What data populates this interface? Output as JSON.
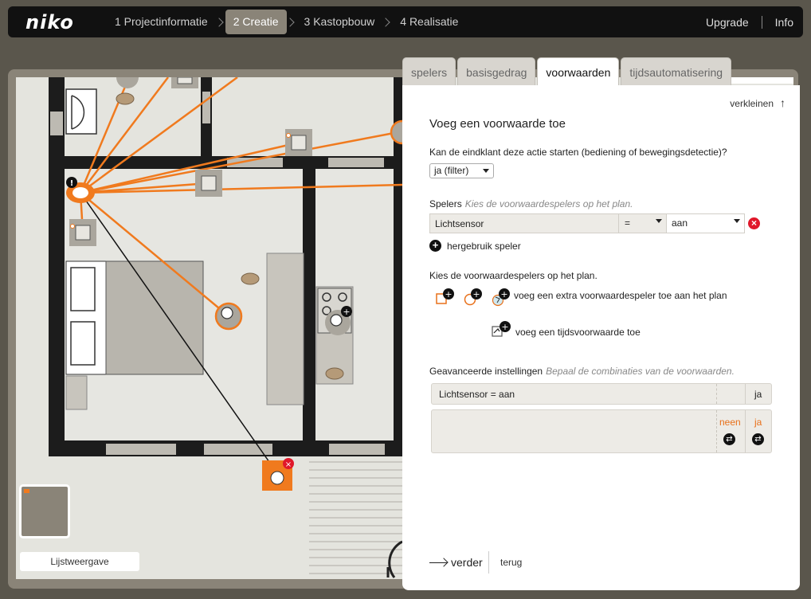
{
  "topbar": {
    "logo": "niko",
    "steps": [
      {
        "label": "1 Projectinformatie",
        "active": false
      },
      {
        "label": "2 Creatie",
        "active": true
      },
      {
        "label": "3 Kastopbouw",
        "active": false
      },
      {
        "label": "4 Realisatie",
        "active": false
      }
    ],
    "upgrade": "Upgrade",
    "info": "Info"
  },
  "plan": {
    "list_view_label": "Lijstweergave"
  },
  "tabs": [
    {
      "label": "spelers",
      "active": false
    },
    {
      "label": "basisgedrag",
      "active": false
    },
    {
      "label": "voorwaarden",
      "active": true
    },
    {
      "label": "tijdsautomatisering",
      "active": false
    }
  ],
  "panel": {
    "shrink_label": "verkleinen",
    "title": "Voeg een voorwaarde toe",
    "start_question": "Kan de eindklant deze actie starten (bediening of bewegingsdetectie)?",
    "start_select_value": "ja (filter)",
    "players_label": "Spelers",
    "players_hint": "Kies de voorwaardespelers op het plan.",
    "player_row": {
      "name": "Lichtsensor",
      "operator": "=",
      "value": "aan"
    },
    "reuse_label": "hergebruik speler",
    "choose_label": "Kies de voorwaardespelers op het plan.",
    "add_extra_label": "voeg een extra voorwaardespeler toe aan het plan",
    "add_time_label": "voeg een tijdsvoorwaarde toe",
    "advanced_label": "Geavanceerde instellingen",
    "advanced_hint": "Bepaal de combinaties van de voorwaarden.",
    "advanced_row1": {
      "text": "Lichtsensor = aan",
      "value": "ja"
    },
    "advanced_row2": {
      "col1": "neen",
      "col2": "ja"
    },
    "next_label": "verder",
    "back_label": "terug"
  },
  "colors": {
    "accent": "#e8701a",
    "delete": "#e0182a",
    "active_step": "#8a8478"
  }
}
